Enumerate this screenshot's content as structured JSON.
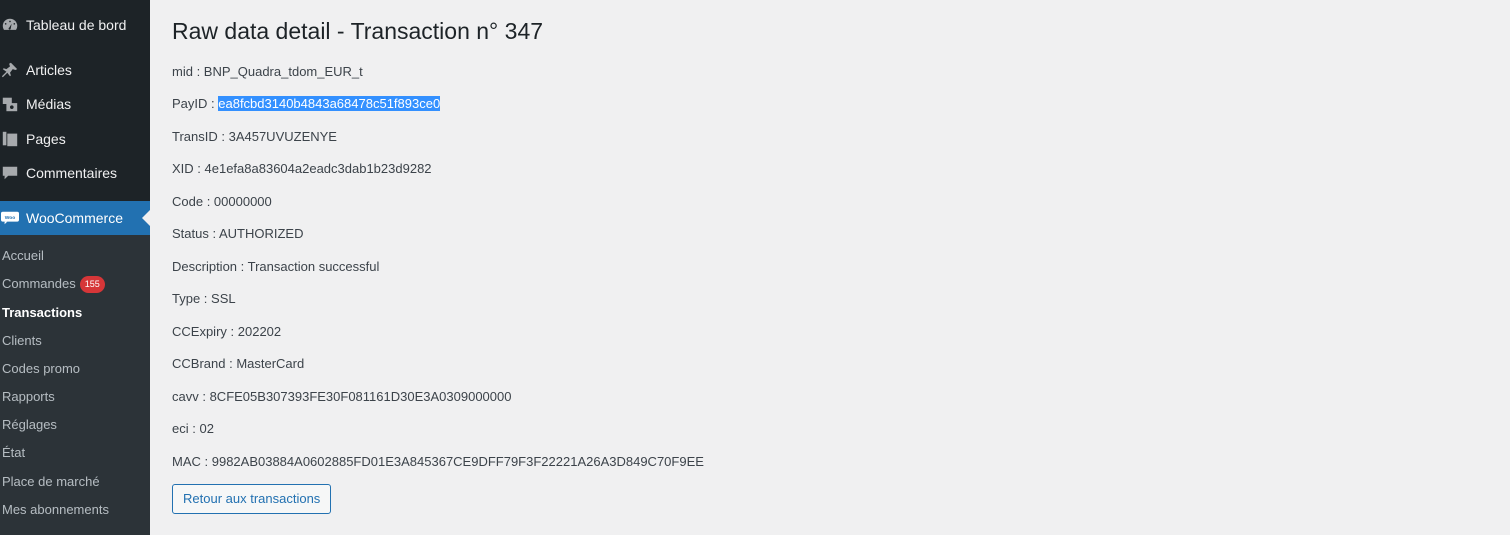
{
  "sidebar": {
    "items": [
      {
        "label": "Tableau de bord",
        "icon": "dashboard-icon"
      },
      {
        "label": "Articles",
        "icon": "pin-icon"
      },
      {
        "label": "Médias",
        "icon": "media-icon"
      },
      {
        "label": "Pages",
        "icon": "pages-icon"
      },
      {
        "label": "Commentaires",
        "icon": "comment-icon"
      },
      {
        "label": "WooCommerce",
        "icon": "woo-icon",
        "active": true
      }
    ],
    "submenu": [
      {
        "label": "Accueil"
      },
      {
        "label": "Commandes",
        "badge": "155"
      },
      {
        "label": "Transactions",
        "current": true
      },
      {
        "label": "Clients"
      },
      {
        "label": "Codes promo"
      },
      {
        "label": "Rapports"
      },
      {
        "label": "Réglages"
      },
      {
        "label": "État"
      },
      {
        "label": "Place de marché"
      },
      {
        "label": "Mes abonnements"
      }
    ]
  },
  "main": {
    "title": "Raw data detail - Transaction n° 347",
    "fields": [
      {
        "key": "mid",
        "value": "BNP_Quadra_tdom_EUR_t"
      },
      {
        "key": "PayID",
        "value": "ea8fcbd3140b4843a68478c51f893ce0",
        "selected": true
      },
      {
        "key": "TransID",
        "value": "3A457UVUZENYE"
      },
      {
        "key": "XID",
        "value": "4e1efa8a83604a2eadc3dab1b23d9282"
      },
      {
        "key": "Code",
        "value": "00000000"
      },
      {
        "key": "Status",
        "value": "AUTHORIZED"
      },
      {
        "key": "Description",
        "value": "Transaction successful"
      },
      {
        "key": "Type",
        "value": "SSL"
      },
      {
        "key": "CCExpiry",
        "value": "202202"
      },
      {
        "key": "CCBrand",
        "value": "MasterCard"
      },
      {
        "key": "cavv",
        "value": "8CFE05B307393FE30F081161D30E3A0309000000"
      },
      {
        "key": "eci",
        "value": "02"
      },
      {
        "key": "MAC",
        "value": "9982AB03884A0602885FD01E3A845367CE9DFF79F3F22221A26A3D849C70F9EE"
      }
    ],
    "separator": " : ",
    "back_button": "Retour aux transactions"
  },
  "colors": {
    "sidebar_bg": "#1d2327",
    "submenu_bg": "#2c3338",
    "accent": "#2271b1",
    "badge": "#d63638",
    "selection": "#3390ff"
  }
}
